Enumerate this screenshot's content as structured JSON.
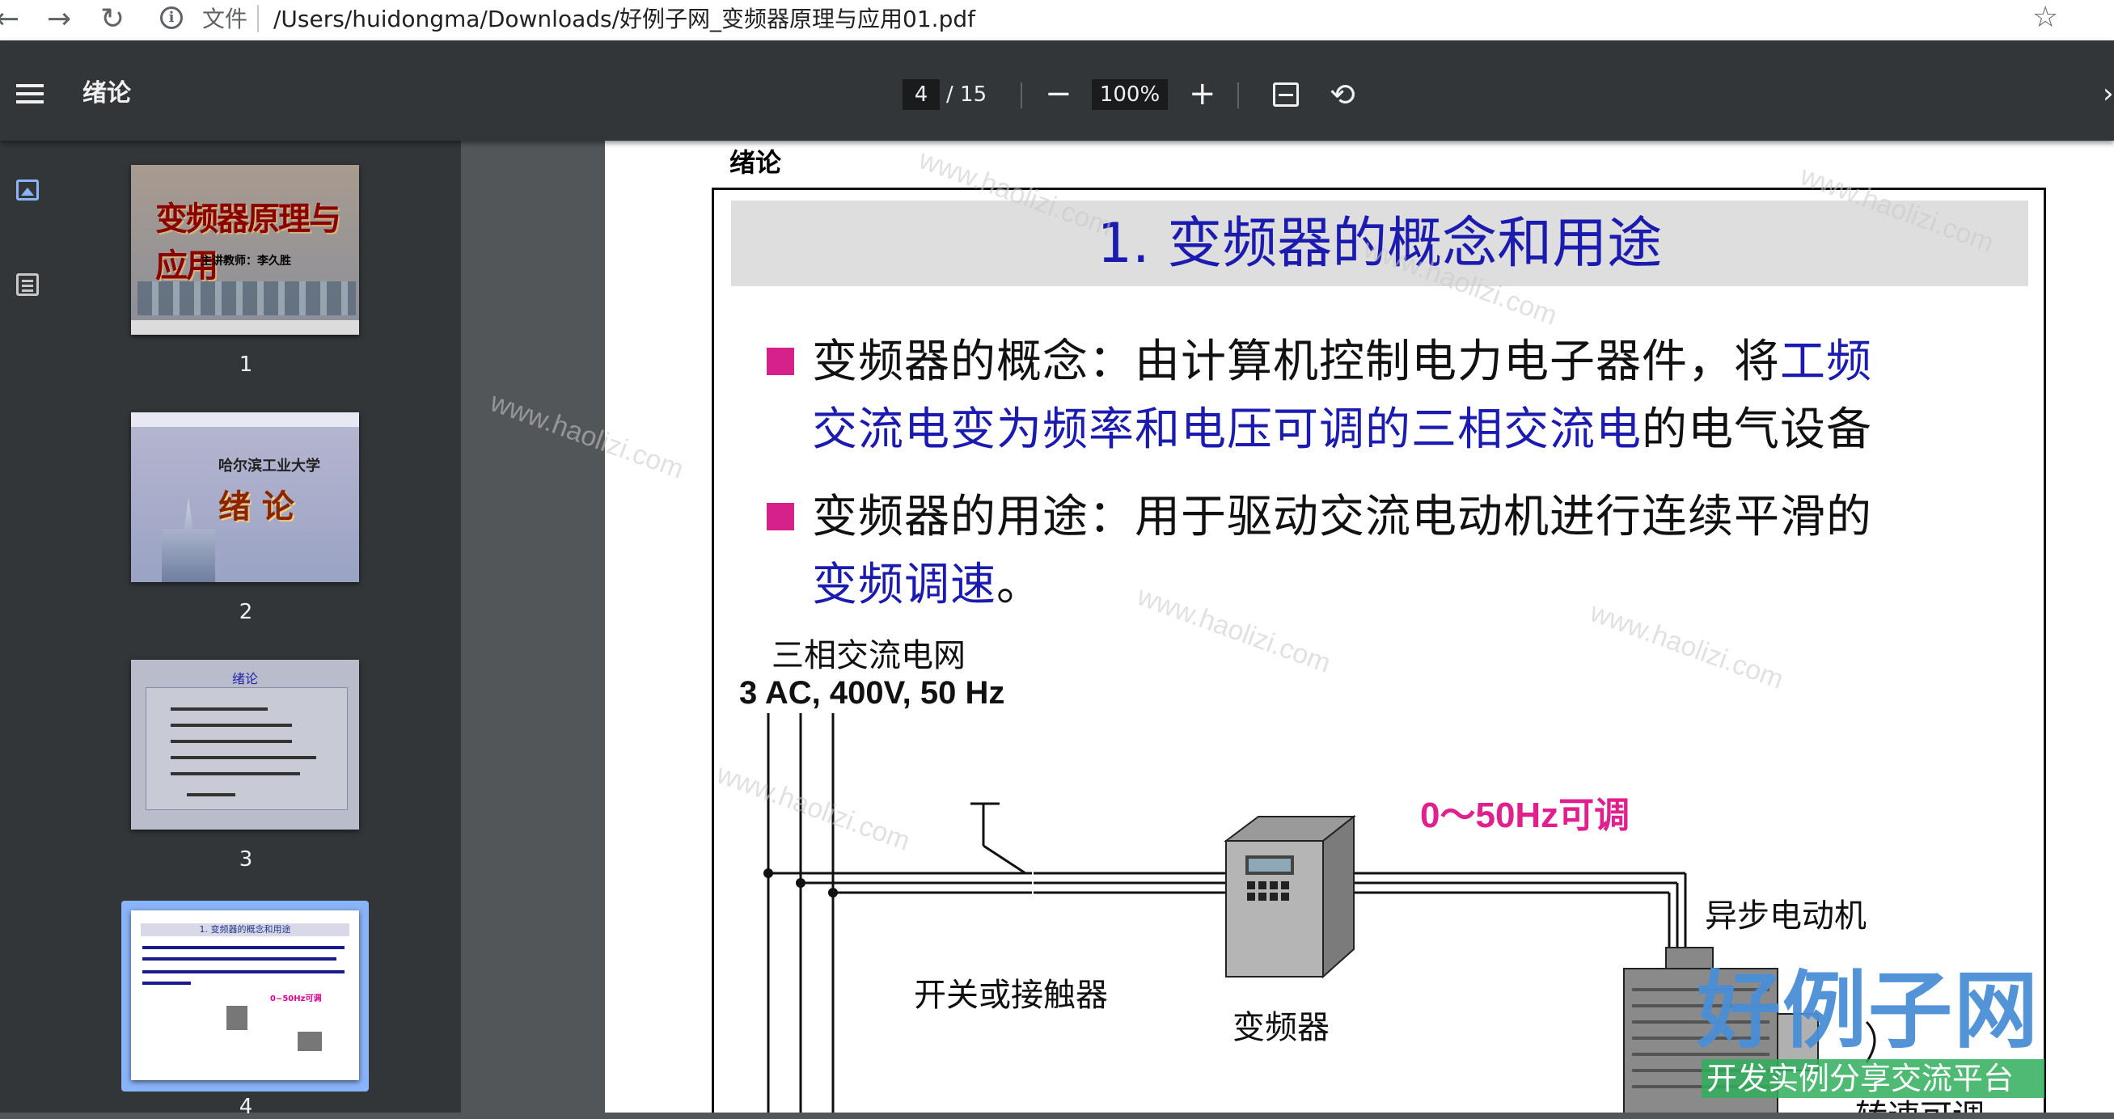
{
  "browser": {
    "scheme_label": "文件",
    "url": "/Users/huidongma/Downloads/好例子网_变频器原理与应用01.pdf"
  },
  "toolbar": {
    "doc_title": "绪论",
    "current_page": "4",
    "page_total": "/ 15",
    "zoom": "100%"
  },
  "thumbnails": [
    {
      "number": "1",
      "title": "变频器原理与应用",
      "sub": "主讲教师：李久胜"
    },
    {
      "number": "2",
      "title": "绪 论",
      "school": "哈尔滨工业大学"
    },
    {
      "number": "3",
      "title": "绪论"
    },
    {
      "number": "4",
      "title": "1. 变频器的概念和用途",
      "red": "0~50Hz可调"
    }
  ],
  "page": {
    "header": "绪论",
    "title": "1. 变频器的概念和用途",
    "b1_l1_a": "变频器的概念：由计算机控制电力电子器件，将",
    "b1_l1_b": "工频",
    "b1_l2_a": "交流电变为频率和电压可调的三相交流电",
    "b1_l2_b": "的电气设备",
    "b2_l1": "变频器的用途：用于驱动交流电动机进行连续平滑的",
    "b2_l2_a": "变频调速",
    "b2_l2_b": "。",
    "diagram": {
      "grid_label": "三相交流电网",
      "grid_spec": "3 AC, 400V, 50 Hz",
      "switch_label": "开关或接触器",
      "inverter_label": "变频器",
      "freq_label": "0～50Hz可调",
      "motor_label": "异步电动机",
      "speed_label": "转速可调"
    }
  },
  "watermark": {
    "logo": "好例子网",
    "slogan": "开发实例分享交流平台",
    "tile": "www.haolizi.com"
  },
  "colors": {
    "accent_blue": "#1b1bb0",
    "bullet_magenta": "#d6208a",
    "freq_magenta": "#e0208f",
    "toolbar_bg": "#323639",
    "viewer_bg": "#525659"
  }
}
